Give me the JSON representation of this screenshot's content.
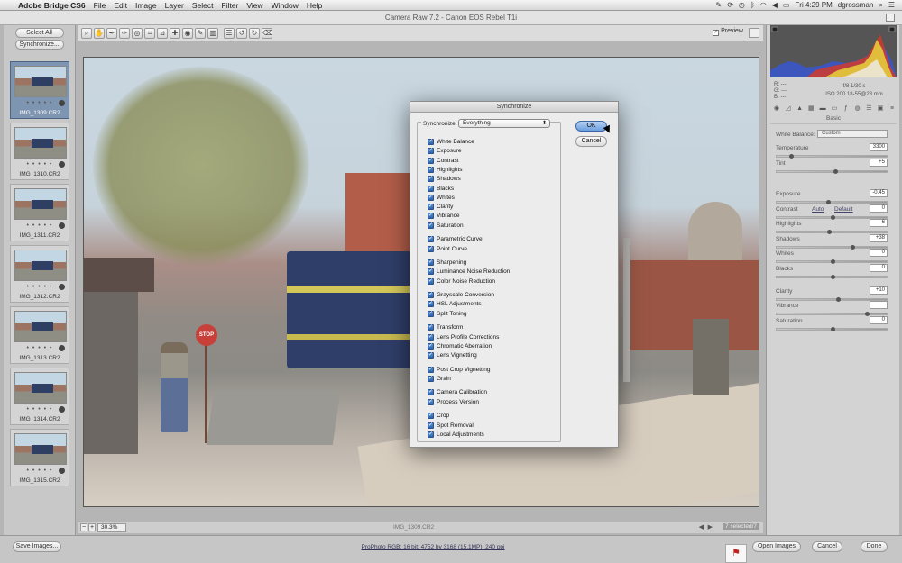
{
  "menubar": {
    "app": "Adobe Bridge CS6",
    "items": [
      "File",
      "Edit",
      "Image",
      "Layer",
      "Select",
      "Filter",
      "View",
      "Window",
      "Help"
    ],
    "clock": "Fri 4:29 PM",
    "user": "dgrossman"
  },
  "window": {
    "title": "Camera Raw 7.2  -  Canon EOS Rebel T1i"
  },
  "left_panel": {
    "select_all": "Select All",
    "synchronize": "Synchronize...",
    "thumbs": [
      {
        "name": "IMG_1309.CR2",
        "dots": "• • • • •"
      },
      {
        "name": "IMG_1310.CR2",
        "dots": "• • • • •"
      },
      {
        "name": "IMG_1311.CR2",
        "dots": "• • • • •"
      },
      {
        "name": "IMG_1312.CR2",
        "dots": "• • • • •"
      },
      {
        "name": "IMG_1313.CR2",
        "dots": "• • • • •"
      },
      {
        "name": "IMG_1314.CR2",
        "dots": "• • • • •"
      },
      {
        "name": "IMG_1315.CR2",
        "dots": "• • • • •"
      }
    ]
  },
  "toolbar": {
    "preview_label": "Preview"
  },
  "photo_signs": {
    "stop": "STOP"
  },
  "status": {
    "zoom": "30.3%",
    "filename": "IMG_1309.CR2",
    "selected": "7 selected/7"
  },
  "dialog": {
    "title": "Synchronize",
    "sync_label": "Synchronize:",
    "sync_value": "Everything",
    "ok": "OK",
    "cancel": "Cancel",
    "groups": [
      [
        "White Balance",
        "Exposure",
        "Contrast",
        "Highlights",
        "Shadows",
        "Blacks",
        "Whites",
        "Clarity",
        "Vibrance",
        "Saturation"
      ],
      [
        "Parametric Curve",
        "Point Curve"
      ],
      [
        "Sharpening",
        "Luminance Noise Reduction",
        "Color Noise Reduction"
      ],
      [
        "Grayscale Conversion",
        "HSL Adjustments",
        "Split Toning"
      ],
      [
        "Transform",
        "Lens Profile Corrections",
        "Chromatic Aberration",
        "Lens Vignetting"
      ],
      [
        "Post Crop Vignetting",
        "Grain"
      ],
      [
        "Camera Calibration",
        "Process Version"
      ],
      [
        "Crop",
        "Spot Removal",
        "Local Adjustments"
      ]
    ]
  },
  "right_panel": {
    "rgb": {
      "r": "R:  ---",
      "g": "G:  ---",
      "b": "B:  ---"
    },
    "camera": {
      "line1": "f/8     1/30 s",
      "line2": "ISO 200    18-55@28 mm"
    },
    "panel_title": "Basic",
    "white_balance": {
      "label": "White Balance:",
      "value": "Custom"
    },
    "auto": "Auto",
    "default": "Default",
    "sliders": [
      {
        "label": "Temperature",
        "value": "3300",
        "pos": 0.12
      },
      {
        "label": "Tint",
        "value": "+5",
        "pos": 0.53
      },
      {
        "label": "Exposure",
        "value": "-0.45",
        "pos": 0.46
      },
      {
        "label": "Contrast",
        "value": "0",
        "pos": 0.5
      },
      {
        "label": "Highlights",
        "value": "-6",
        "pos": 0.47
      },
      {
        "label": "Shadows",
        "value": "+38",
        "pos": 0.69
      },
      {
        "label": "Whites",
        "value": "0",
        "pos": 0.5
      },
      {
        "label": "Blacks",
        "value": "0",
        "pos": 0.5
      },
      {
        "label": "Clarity",
        "value": "+10",
        "pos": 0.55
      },
      {
        "label": "Vibrance",
        "value": "",
        "pos": 0.82
      },
      {
        "label": "Saturation",
        "value": "0",
        "pos": 0.5
      }
    ]
  },
  "bottom": {
    "save_images": "Save Images...",
    "workflow": "ProPhoto RGB; 16 bit; 4752 by 3168 (15.1MP); 240 ppi",
    "open_images": "Open Images",
    "cancel": "Cancel",
    "done": "Done"
  },
  "colors": {
    "ok_button": "#6b9edf",
    "checkbox": "#2d63ac",
    "selected_thumb": "#7e95b1"
  }
}
